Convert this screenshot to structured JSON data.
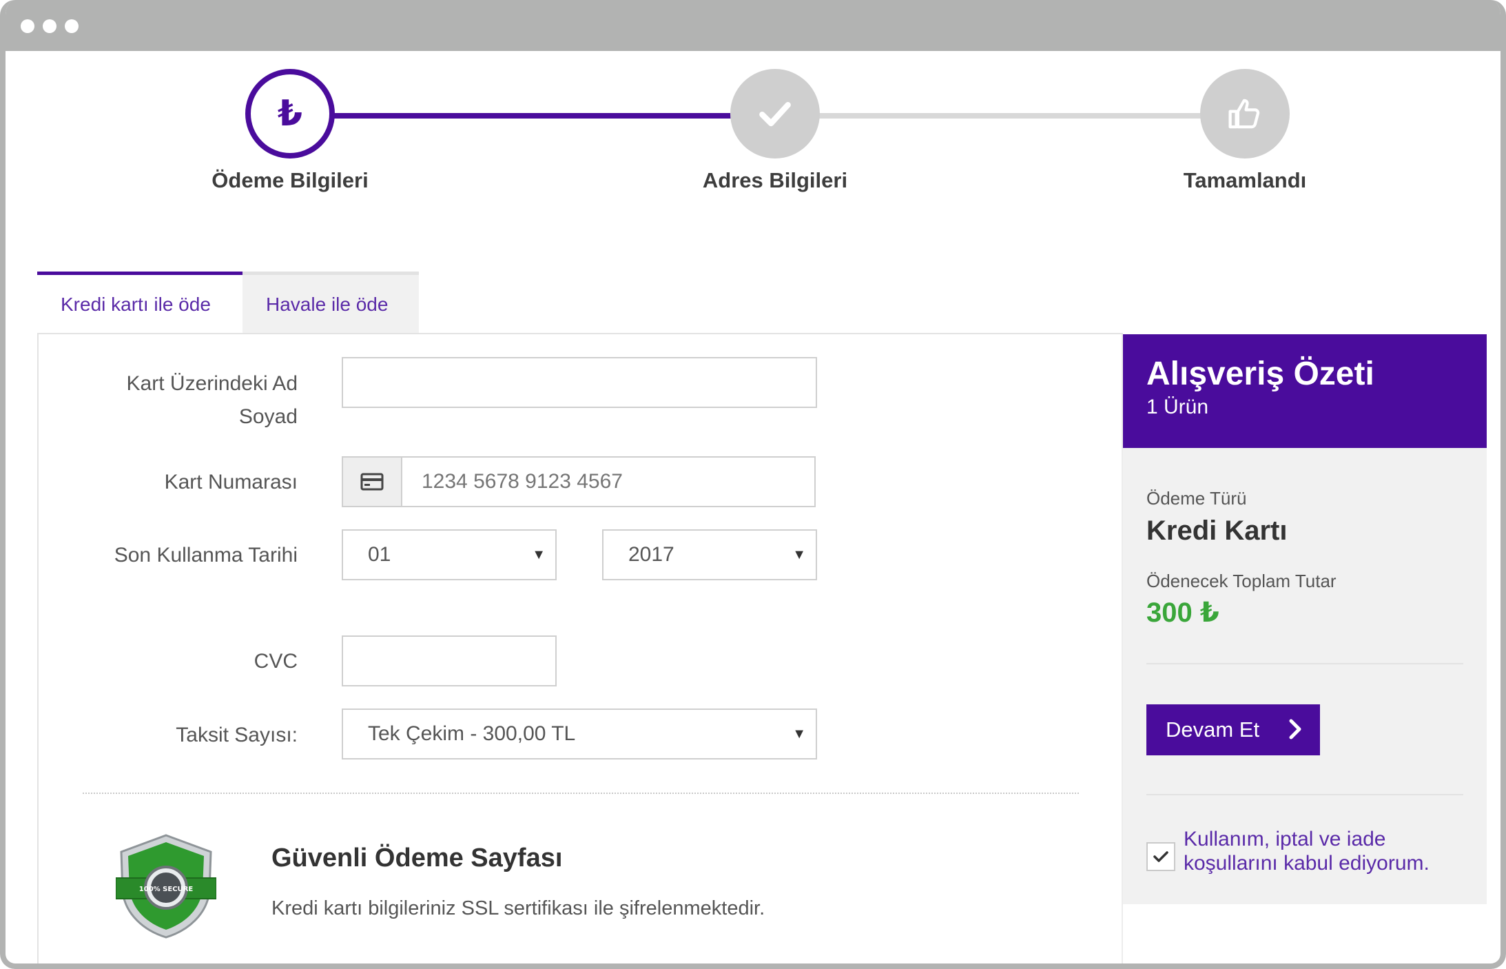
{
  "steps": [
    {
      "label": "Ödeme Bilgileri",
      "icon": "lira-icon",
      "symbol": "₺",
      "state": "active"
    },
    {
      "label": "Adres Bilgileri",
      "icon": "check-icon",
      "state": "inactive"
    },
    {
      "label": "Tamamlandı",
      "icon": "thumbs-up-icon",
      "state": "inactive"
    }
  ],
  "tabs": [
    {
      "label": "Kredi kartı ile öde",
      "active": true
    },
    {
      "label": "Havale ile öde",
      "active": false
    }
  ],
  "form": {
    "name_label": "Kart Üzerindeki Ad Soyad",
    "name_value": "",
    "card_label": "Kart Numarası",
    "card_placeholder": "1234 5678 9123 4567",
    "expiry_label": "Son Kullanma Tarihi",
    "expiry_month": "01",
    "expiry_year": "2017",
    "cvc_label": "CVC",
    "cvc_value": "",
    "installment_label": "Taksit Sayısı:",
    "installment_value": "Tek Çekim - 300,00 TL"
  },
  "secure": {
    "title": "Güvenli Ödeme Sayfası",
    "text": "Kredi kartı bilgileriniz SSL sertifikası ile şifrelenmektedir.",
    "badge_text": "100% SECURE"
  },
  "summary": {
    "title": "Alışveriş Özeti",
    "count": "1 Ürün",
    "payment_type_label": "Ödeme Türü",
    "payment_type_value": "Kredi Kartı",
    "total_label": "Ödenecek Toplam Tutar",
    "total_value": "300 ₺",
    "continue_label": "Devam Et",
    "terms_text": "Kullanım, iptal ve iade koşullarını kabul ediyorum.",
    "terms_checked": true
  },
  "colors": {
    "accent": "#4a0c9c",
    "amount": "#3aa63a",
    "link": "#5a2aa8"
  }
}
